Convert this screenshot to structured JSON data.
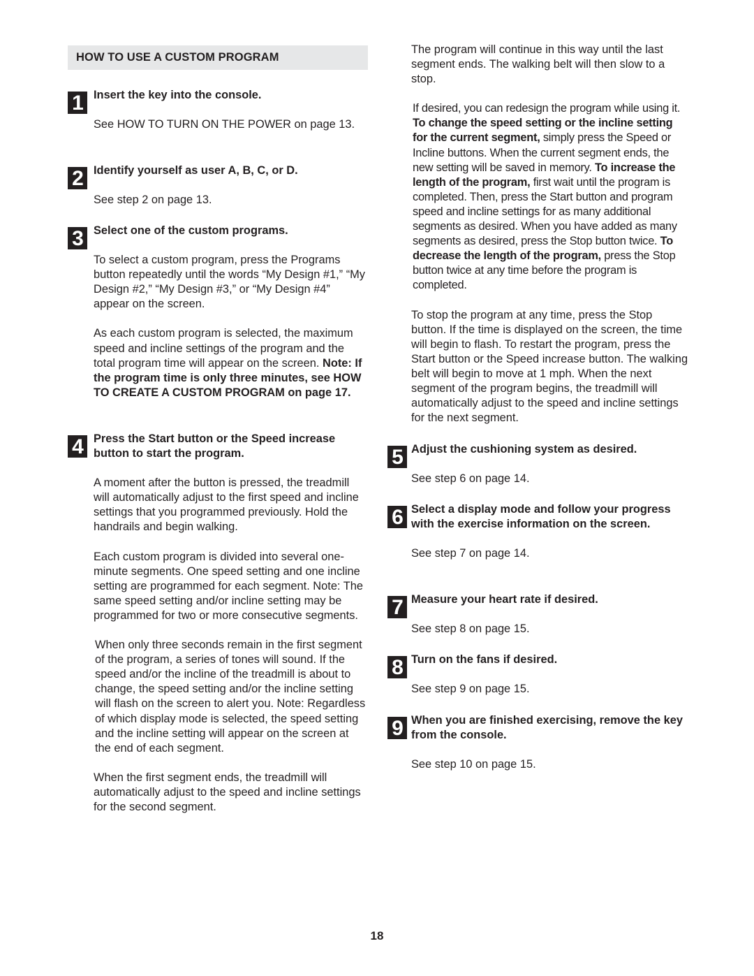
{
  "section": {
    "title": "HOW TO USE A CUSTOM PROGRAM"
  },
  "steps": [
    {
      "number": "1",
      "title": "Insert the key into the console.",
      "body": "See HOW TO TURN ON THE POWER on page 13."
    },
    {
      "number": "2",
      "title": "Identify yourself as user A, B, C, or D.",
      "body": "See step 2 on page 13."
    },
    {
      "number": "3",
      "title": "Select one of the custom programs.",
      "body": "To select a custom program, press the Programs button repeatedly until the words “My Design #1,” “My Design #2,” “My Design #3,” or “My Design #4” appear on the screen.",
      "body2_plain": "As each custom program is selected, the maximum speed and incline settings of the program and the total program time will appear on the screen.",
      "body2_bold": "Note: If the program time is only three minutes, see HOW TO CREATE A CUSTOM PROGRAM on page 17."
    },
    {
      "number": "4",
      "title": "Press the Start button or the Speed increase button to start the program.",
      "paragraphs": [
        "A moment after the button is pressed, the treadmill will automatically adjust to the first speed and incline settings that you programmed previously. Hold the handrails and begin walking.",
        "Each custom program is divided into several one-minute segments. One speed setting and one incline setting are programmed for each segment. Note: The same speed setting and/or incline setting may be programmed for two or more consecutive segments.",
        "When only three seconds remain in the first segment of the program, a series of tones will sound. If the speed and/or the incline of the treadmill is about to change, the speed setting and/or the incline setting will flash on the screen to alert you. Note: Regardless of which display mode is selected, the speed setting and the incline setting will appear on the screen at the end of each segment.",
        "When the first segment ends, the treadmill will automatically adjust to the speed and incline settings for the second segment.",
        "The program will continue in this way until the last segment ends. The walking belt will then slow to a stop."
      ],
      "redesign": {
        "t1": "If desired, you can redesign the program while using it. ",
        "b1": "To change the speed setting or the incline setting for the current segment,",
        "t2": " simply press the Speed or Incline buttons. When the current segment ends, the new setting will be saved in memory. ",
        "b2": "To increase the length of the program,",
        "t3": " first wait until the program is completed. Then, press the Start button and program speed and incline settings for as many additional segments as desired. When you have added as many segments as desired, press the Stop button twice. ",
        "b3": "To decrease the length of the program,",
        "t4": " press the Stop button twice at any time before the program is completed."
      },
      "stop": "To stop the program at any time, press the Stop button. If the time is displayed on the screen, the time will begin to flash. To restart the program, press the Start button or the Speed increase button. The walking belt will begin to move at 1 mph. When the next segment of the program begins, the treadmill will automatically adjust to the speed and incline settings for the next segment."
    },
    {
      "number": "5",
      "title": "Adjust the cushioning system as desired.",
      "body": "See step 6 on page 14."
    },
    {
      "number": "6",
      "title": "Select a display mode and follow your progress with the exercise information on the screen.",
      "body": "See step 7 on page 14."
    },
    {
      "number": "7",
      "title": "Measure your heart rate if desired.",
      "body": "See step 8 on page 15."
    },
    {
      "number": "8",
      "title": "Turn on the fans if desired.",
      "body": "See step 9 on page 15."
    },
    {
      "number": "9",
      "title": "When you are finished exercising, remove the key from the console.",
      "body": "See step 10 on page 15."
    }
  ],
  "footer": {
    "page_number": "18"
  }
}
